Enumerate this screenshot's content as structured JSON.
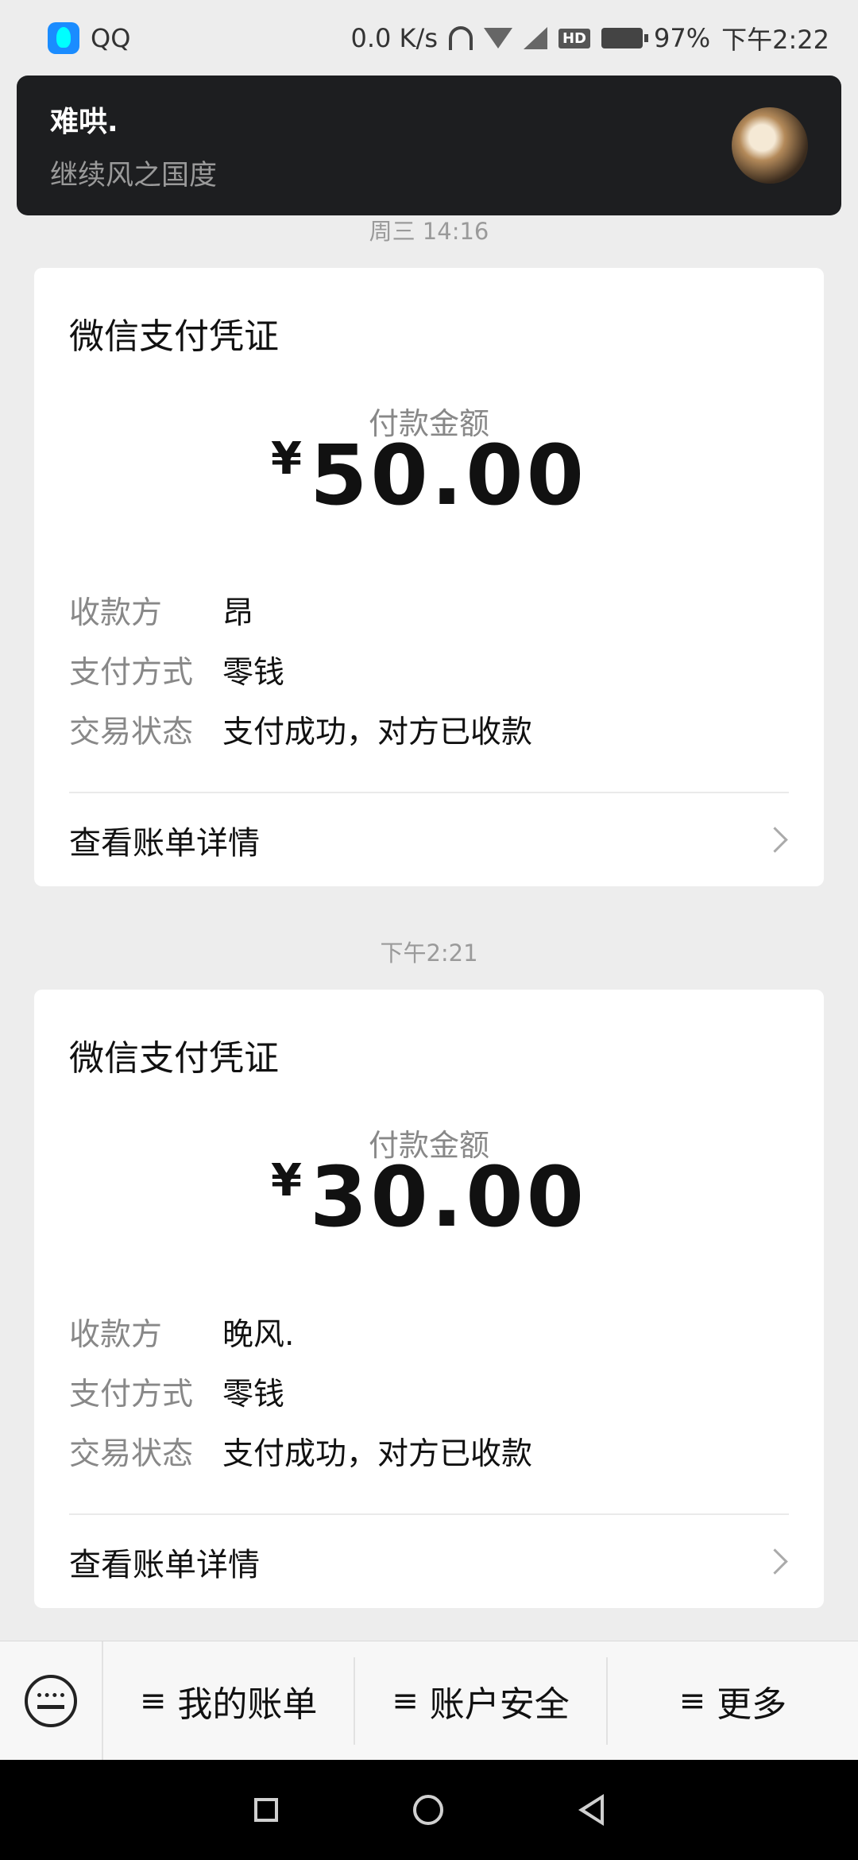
{
  "status_bar": {
    "app": "QQ",
    "speed": "0.0 K/s",
    "battery": "97%",
    "time": "下午2:22"
  },
  "notification": {
    "title": "难哄.",
    "body": "继续风之国度"
  },
  "messages": [
    {
      "time": "周三 14:16",
      "card_title": "微信支付凭证",
      "amount_label": "付款金额",
      "currency": "¥",
      "amount": "50.00",
      "rows": [
        {
          "key": "收款方",
          "value": "昂"
        },
        {
          "key": "支付方式",
          "value": "零钱"
        },
        {
          "key": "交易状态",
          "value": "支付成功，对方已收款"
        }
      ],
      "detail_link": "查看账单详情"
    },
    {
      "time": "下午2:21",
      "card_title": "微信支付凭证",
      "amount_label": "付款金额",
      "currency": "¥",
      "amount": "30.00",
      "rows": [
        {
          "key": "收款方",
          "value": "晚风."
        },
        {
          "key": "支付方式",
          "value": "零钱"
        },
        {
          "key": "交易状态",
          "value": "支付成功，对方已收款"
        }
      ],
      "detail_link": "查看账单详情"
    }
  ],
  "menu": {
    "items": [
      {
        "icon": "≡",
        "label": "我的账单"
      },
      {
        "icon": "≡",
        "label": "账户安全"
      },
      {
        "icon": "≡",
        "label": "更多"
      }
    ]
  }
}
